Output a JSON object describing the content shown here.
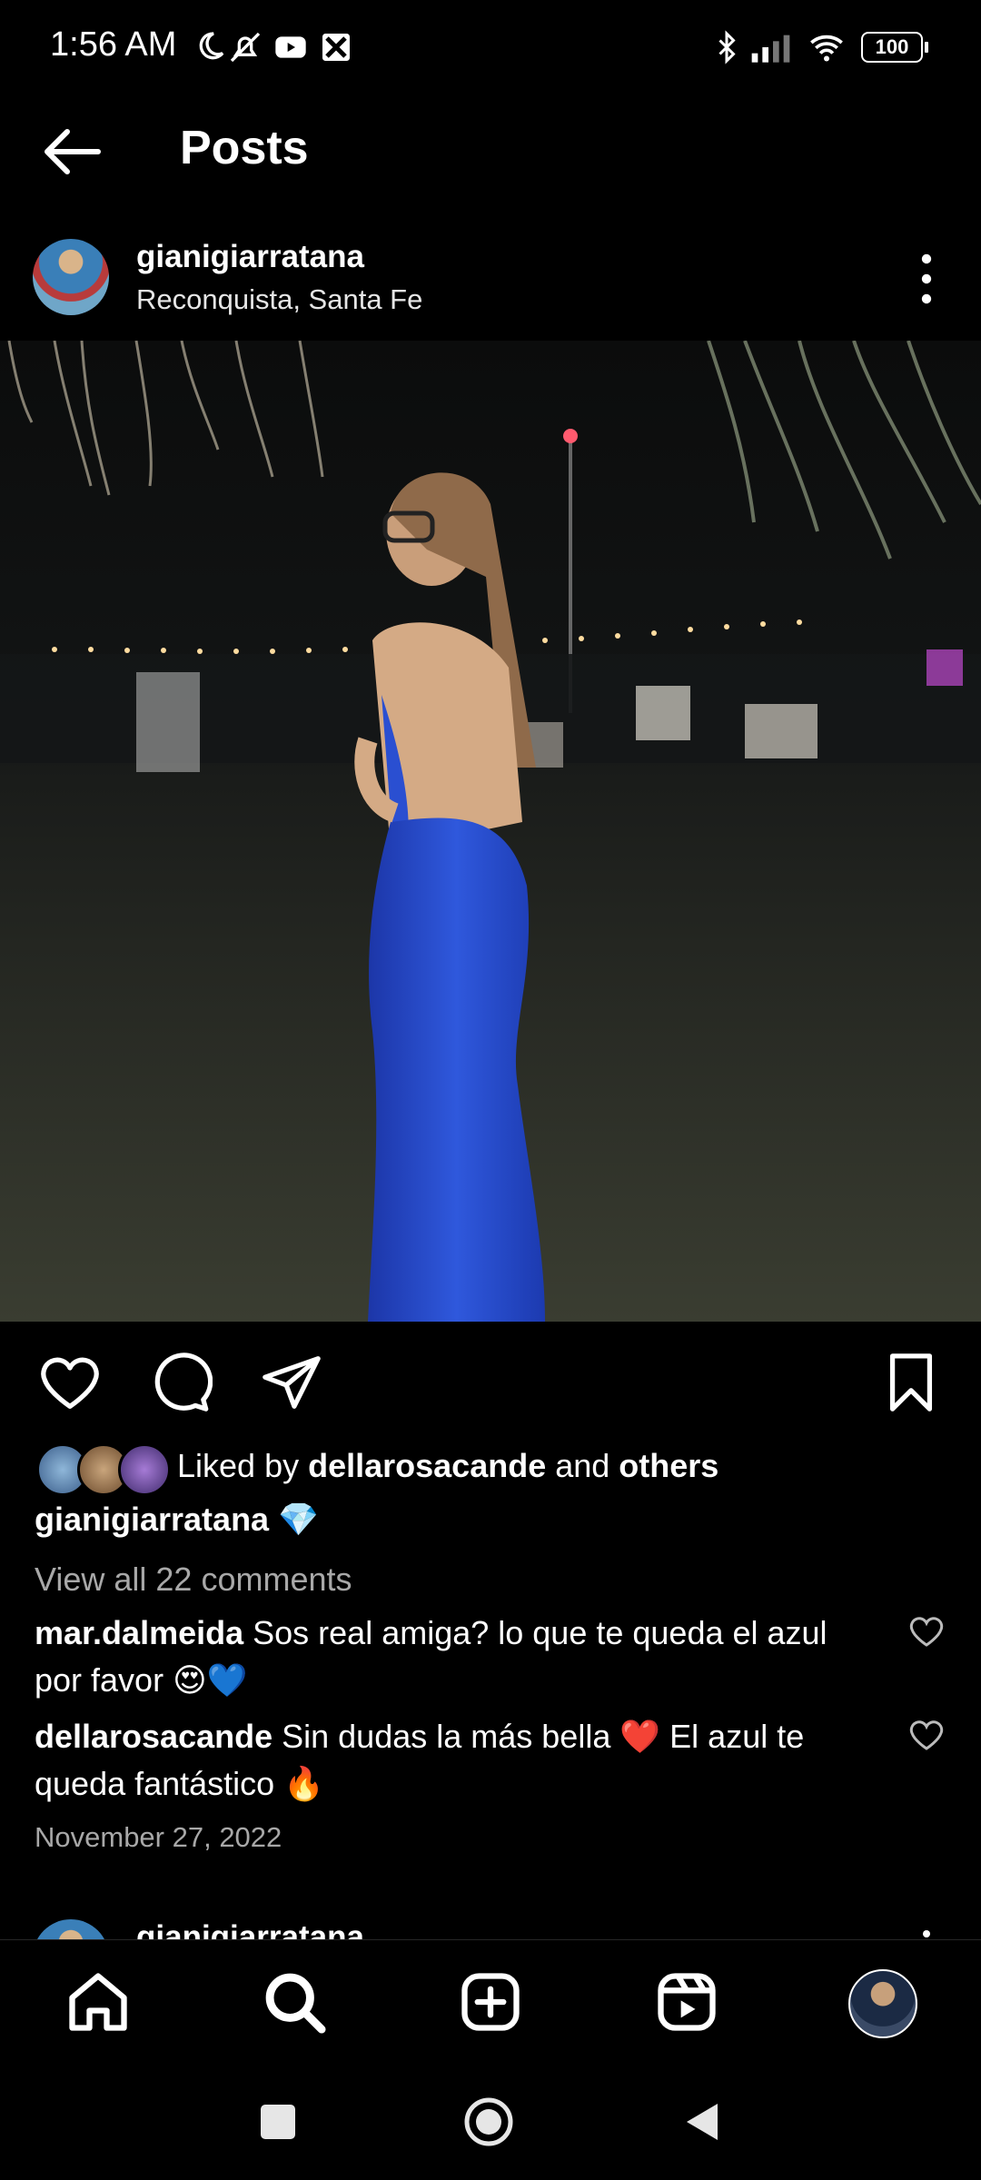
{
  "status": {
    "time": "1:56 AM",
    "battery": "100"
  },
  "header": {
    "title": "Posts"
  },
  "post": {
    "username": "gianigiarratana",
    "location": "Reconquista, Santa Fe",
    "liked_prefix": "Liked by ",
    "liked_user": "dellarosacande",
    "liked_mid": " and ",
    "liked_others": "others",
    "caption_user": "gianigiarratana",
    "caption_emoji": "💎",
    "view_all": "View all 22 comments",
    "comments": [
      {
        "user": "mar.dalmeida",
        "text": " Sos real amiga? lo que te queda el azul por favor 😍💙"
      },
      {
        "user": "dellarosacande",
        "text": " Sin dudas la más bella ❤️ El azul te queda fantástico 🔥"
      }
    ],
    "date": "November 27, 2022"
  },
  "next_post": {
    "username": "gianigiarratana"
  },
  "icons": {
    "back": "arrow-left-icon",
    "more": "more-vertical-icon",
    "like": "heart-icon",
    "comment": "comment-icon",
    "share": "send-icon",
    "save": "bookmark-icon",
    "home": "home-icon",
    "search": "search-icon",
    "create": "plus-square-icon",
    "reels": "reels-icon",
    "profile": "profile-avatar"
  },
  "colors": {
    "background": "#000000",
    "text": "#ffffff",
    "muted": "#a8a8a8",
    "dress": "#2a4fd1"
  }
}
